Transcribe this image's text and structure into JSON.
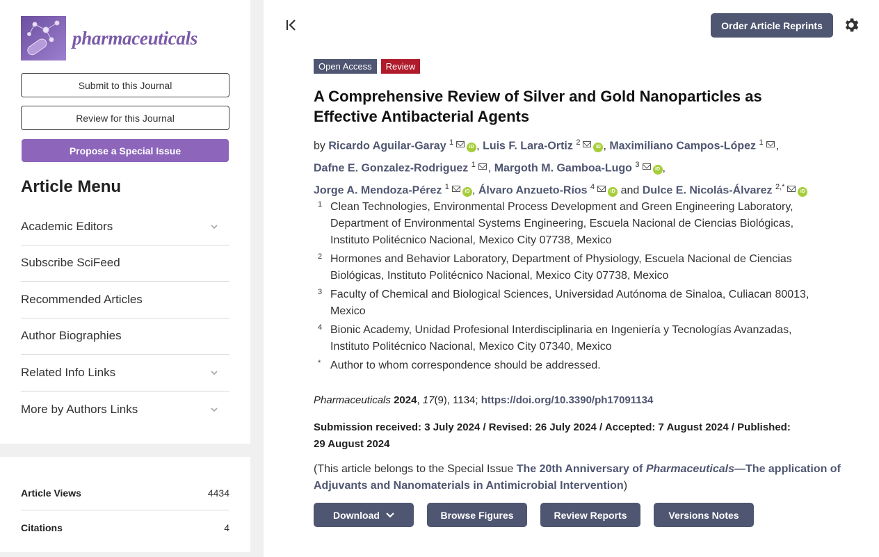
{
  "sidebar": {
    "logo_text": "pharmaceuticals",
    "submit_label": "Submit to this Journal",
    "review_label": "Review for this Journal",
    "propose_label": "Propose a Special Issue",
    "menu_title": "Article Menu",
    "menu_items": [
      {
        "label": "Academic Editors",
        "expandable": true
      },
      {
        "label": "Subscribe SciFeed",
        "expandable": false
      },
      {
        "label": "Recommended Articles",
        "expandable": false
      },
      {
        "label": "Author Biographies",
        "expandable": false
      },
      {
        "label": "Related Info Links",
        "expandable": true
      },
      {
        "label": "More by Authors Links",
        "expandable": true
      }
    ],
    "stats": [
      {
        "label": "Article Views",
        "value": "4434"
      },
      {
        "label": "Citations",
        "value": "4"
      }
    ]
  },
  "header": {
    "order_label": "Order Article Reprints"
  },
  "article": {
    "badges": {
      "open_access": "Open Access",
      "type": "Review"
    },
    "title": "A Comprehensive Review of Silver and Gold Nanoparticles as Effective Antibacterial Agents",
    "by": "by",
    "and": "and",
    "authors": [
      {
        "name": "Ricardo Aguilar-Garay",
        "sup": "1"
      },
      {
        "name": "Luis F. Lara-Ortiz",
        "sup": "2"
      },
      {
        "name": "Maximiliano Campos-López",
        "sup": "1"
      },
      {
        "name": "Dafne E. Gonzalez-Rodriguez",
        "sup": "1"
      },
      {
        "name": "Margoth M. Gamboa-Lugo",
        "sup": "3"
      },
      {
        "name": "Jorge A. Mendoza-Pérez",
        "sup": "1"
      },
      {
        "name": "Álvaro Anzueto-Ríos",
        "sup": "4"
      },
      {
        "name": "Dulce E. Nicolás-Álvarez",
        "sup": "2,*"
      }
    ],
    "orcid_label": "iD",
    "affiliations": [
      {
        "num": "1",
        "text": "Clean Technologies, Environmental Process Development and Green Engineering Laboratory, Department of Environmental Systems Engineering, Escuela Nacional de Ciencias Biológicas, Instituto Politécnico Nacional, Mexico City 07738, Mexico"
      },
      {
        "num": "2",
        "text": "Hormones and Behavior Laboratory, Department of Physiology, Escuela Nacional de Ciencias Biológicas, Instituto Politécnico Nacional, Mexico City 07738, Mexico"
      },
      {
        "num": "3",
        "text": "Faculty of Chemical and Biological Sciences, Universidad Autónoma de Sinaloa, Culiacan 80013, Mexico"
      },
      {
        "num": "4",
        "text": "Bionic Academy, Unidad Profesional Interdisciplinaria en Ingeniería y Tecnologías Avanzadas, Instituto Politécnico Nacional, Mexico City 07340, Mexico"
      },
      {
        "num": "*",
        "text": "Author to whom correspondence should be addressed."
      }
    ],
    "citation": {
      "journal": "Pharmaceuticals",
      "year": "2024",
      "volume": "17",
      "issue": "(9), 1134;",
      "doi": "https://doi.org/10.3390/ph17091134"
    },
    "dates": "Submission received: 3 July 2024 / Revised: 26 July 2024 / Accepted: 7 August 2024 / Published: 29 August 2024",
    "special_issue": {
      "prefix": "(This article belongs to the Special Issue ",
      "title_a": "The 20th Anniversary of ",
      "title_italic": "Pharmaceuticals",
      "title_b": "—The application of Adjuvants and Nanomaterials in Antimicrobial Intervention",
      "suffix": ")"
    },
    "actions": {
      "download": "Download",
      "browse_figures": "Browse Figures",
      "review_reports": "Review Reports",
      "versions_notes": "Versions Notes"
    }
  },
  "colors": {
    "accent": "#4f5671",
    "brand_purple": "#8d66bb",
    "review_red": "#b01b2b",
    "orcid_green": "#a6ce39"
  }
}
